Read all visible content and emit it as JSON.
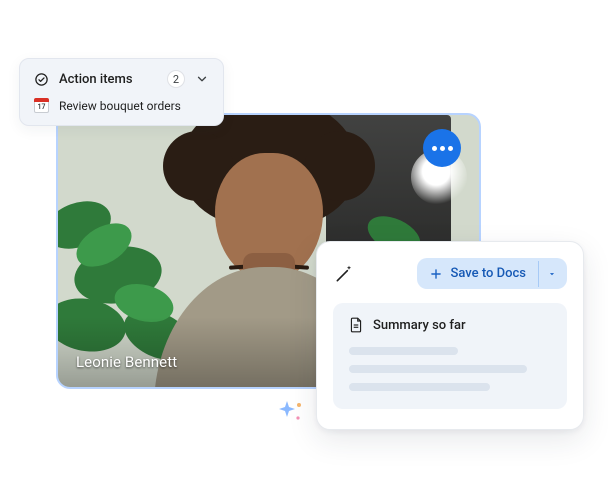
{
  "video": {
    "participant_name": "Leonie Bennett"
  },
  "action_items": {
    "title": "Action items",
    "count": "2",
    "items": [
      {
        "icon_day": "17",
        "text": "Review bouquet orders"
      }
    ]
  },
  "summary": {
    "save_label": "Save to Docs",
    "heading": "Summary so far"
  },
  "colors": {
    "accent_blue": "#1a73e8",
    "pill_blue": "#d6e7fb",
    "card_grey": "#f1f4f9"
  }
}
